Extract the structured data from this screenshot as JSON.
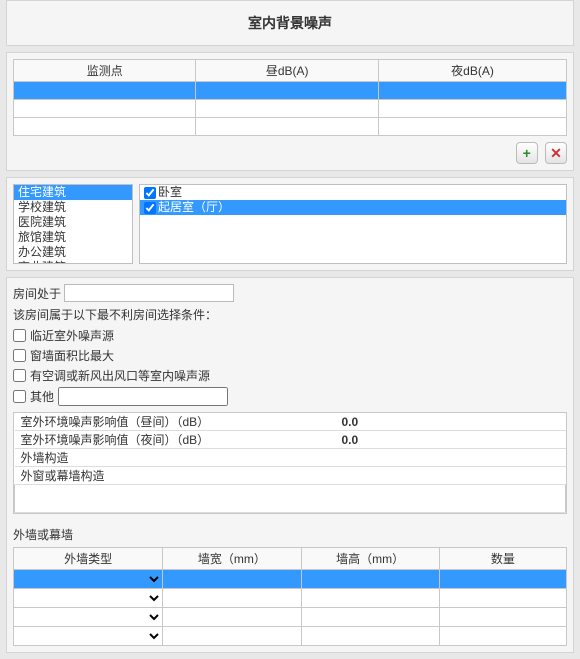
{
  "header": {
    "title": "室内背景噪声"
  },
  "monitorTable": {
    "headers": [
      "监测点",
      "昼dB(A)",
      "夜dB(A)"
    ]
  },
  "toolbar": {
    "add_label": "+",
    "del_label": "✕"
  },
  "leftList": {
    "items": [
      {
        "label": "住宅建筑",
        "selected": true
      },
      {
        "label": "学校建筑",
        "selected": false
      },
      {
        "label": "医院建筑",
        "selected": false
      },
      {
        "label": "旅馆建筑",
        "selected": false
      },
      {
        "label": "办公建筑",
        "selected": false
      },
      {
        "label": "商业建筑",
        "selected": false
      }
    ]
  },
  "rightList": {
    "items": [
      {
        "label": "卧室",
        "checked": true,
        "selected": false
      },
      {
        "label": "起居室（厅）",
        "checked": true,
        "selected": true
      }
    ]
  },
  "roomForm": {
    "at_label": "房间处于",
    "at_value": "",
    "cond_title": "该房间属于以下最不利房间选择条件：",
    "chk_near": {
      "label": "临近室外噪声源",
      "checked": false
    },
    "chk_window": {
      "label": "窗墙面积比最大",
      "checked": false
    },
    "chk_hvac": {
      "label": "有空调或新风出风口等室内噪声源",
      "checked": false
    },
    "chk_other": {
      "label": "其他",
      "checked": false,
      "value": ""
    }
  },
  "paramTable": {
    "rows": [
      {
        "name": "室外环境噪声影响值（昼间）（dB）",
        "value": "0.0"
      },
      {
        "name": "室外环境噪声影响值（夜间）（dB）",
        "value": "0.0"
      },
      {
        "name": "外墙构造",
        "value": ""
      },
      {
        "name": "外窗或幕墙构造",
        "value": ""
      }
    ]
  },
  "wallSection": {
    "title": "外墙或幕墙",
    "headers": [
      "外墙类型",
      "墙宽（mm）",
      "墙高（mm）",
      "数量"
    ]
  },
  "chart_data": null
}
